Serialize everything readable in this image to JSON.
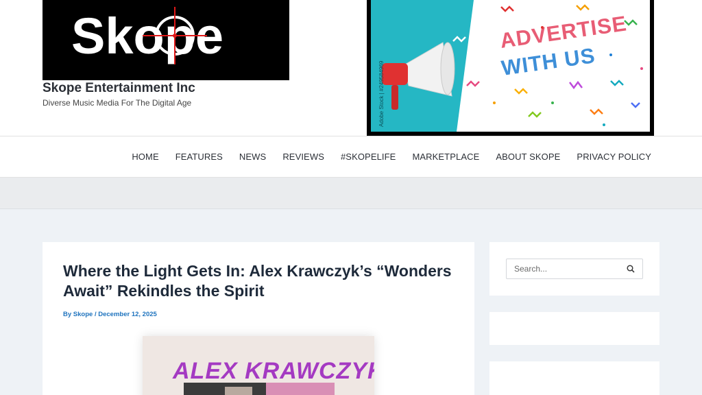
{
  "header": {
    "logo_text": "Skope",
    "site_title": "Skope Entertainment Inc",
    "tagline": "Diverse Music Media For The Digital Age",
    "ad": {
      "line1": "ADVERTISE",
      "line2": "WITH US",
      "watermark": "Adobe Stock | #249584969"
    }
  },
  "nav": {
    "items": [
      {
        "label": "HOME"
      },
      {
        "label": "FEATURES"
      },
      {
        "label": "NEWS"
      },
      {
        "label": "REVIEWS"
      },
      {
        "label": "#SKOPELIFE"
      },
      {
        "label": "MARKETPLACE"
      },
      {
        "label": "ABOUT SKOPE"
      },
      {
        "label": "PRIVACY POLICY"
      }
    ]
  },
  "article": {
    "title": "Where the Light Gets In: Alex Krawczyk’s “Wonders Await” Rekindles the Spirit",
    "meta_prefix": "By ",
    "author": "Skope",
    "separator": " / ",
    "date": "December 12, 2025",
    "image_text": "ALEX KRAWCZYK"
  },
  "sidebar": {
    "search": {
      "placeholder": "Search..."
    }
  },
  "colors": {
    "link": "#1e73be",
    "title": "#1e2a3a",
    "content_bg": "#eef2f6"
  }
}
